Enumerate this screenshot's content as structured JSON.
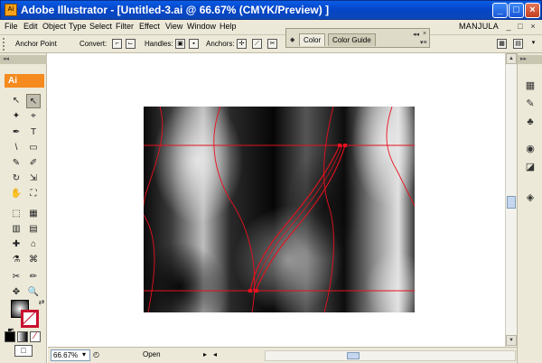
{
  "window": {
    "title": "Adobe Illustrator - [Untitled-3.ai @ 66.67% (CMYK/Preview) ]",
    "app_icon_text": "Ai",
    "minimize": "_",
    "maximize": "□",
    "close": "×"
  },
  "menu": {
    "items": [
      "File",
      "Edit",
      "Object",
      "Type",
      "Select",
      "Filter",
      "Effect",
      "View",
      "Window",
      "Help"
    ],
    "user": "MANJULA",
    "doc_min": "_",
    "doc_restore": "□",
    "doc_close": "×"
  },
  "control_bar": {
    "mode_label": "Anchor Point",
    "convert_label": "Convert:",
    "handles_label": "Handles:",
    "anchors_label": "Anchors:"
  },
  "color_panel": {
    "tabs": [
      "Color",
      "Color Guide"
    ],
    "active_tab": "Color"
  },
  "tools": {
    "logo": "Ai",
    "dock_toggle": "◂◂",
    "glyphs": [
      "↖",
      "↖",
      "✦",
      "⌖",
      "✒",
      "T",
      "\\",
      "▭",
      "✎",
      "✐",
      "↻",
      "⇲",
      "✋",
      "⛶",
      "⬚",
      "▦",
      "▥",
      "▤",
      "✚",
      "⌂",
      "⚗",
      "⌘",
      "✂",
      "✏",
      "✥",
      "🔍"
    ],
    "screen_mode_label": "□"
  },
  "right_dock": {
    "dock_toggle": "▸▸",
    "icons": [
      "swatches-grid",
      "layers",
      "symbols",
      "appearance",
      "graphic-styles",
      "layer-stack"
    ]
  },
  "status": {
    "zoom": "66.67%",
    "state": "Open",
    "artboard_nav_first": "◂",
    "artboard_nav_last": "▸"
  },
  "colors": {
    "accent": "#f58a1f",
    "titlebar": "#0a5de6",
    "path_red": "#e8101e"
  }
}
